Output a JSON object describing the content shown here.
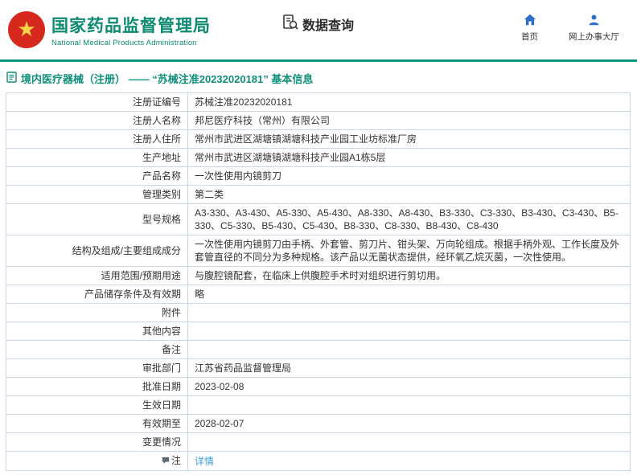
{
  "colors": {
    "accent_teal": "#0f9382",
    "title_teal": "#0d8a72",
    "nav_blue": "#2e6ec8",
    "emblem_red": "#d7281d",
    "emblem_gold": "#f8d549",
    "link_blue": "#3f9fd8",
    "table_border": "#c9d7e4"
  },
  "header": {
    "org_name_cn": "国家药品监督管理局",
    "org_name_en": "National Medical Products Administration",
    "section_title": "数据查询",
    "nav": [
      {
        "label": "首页",
        "icon": "home-icon"
      },
      {
        "label": "网上办事大厅",
        "icon": "person-icon"
      }
    ]
  },
  "breadcrumb": {
    "text": "境内医疗器械（注册） —— “苏械注准20232020181” 基本信息"
  },
  "table": {
    "rows": [
      {
        "label": "注册证编号",
        "value": "苏械注准20232020181"
      },
      {
        "label": "注册人名称",
        "value": "邦尼医疗科技（常州）有限公司"
      },
      {
        "label": "注册人住所",
        "value": "常州市武进区湖塘镇湖塘科技产业园工业坊标准厂房"
      },
      {
        "label": "生产地址",
        "value": "常州市武进区湖塘镇湖塘科技产业园A1栋5层"
      },
      {
        "label": "产品名称",
        "value": "一次性使用内镜剪刀"
      },
      {
        "label": "管理类别",
        "value": "第二类"
      },
      {
        "label": "型号规格",
        "value": "A3-330、A3-430、A5-330、A5-430、A8-330、A8-430、B3-330、C3-330、B3-430、C3-430、B5-330、C5-330、B5-430、C5-430、B8-330、C8-330、B8-430、C8-430"
      },
      {
        "label": "结构及组成/主要组成成分",
        "value": "一次性使用内镜剪刀由手柄、外套管、剪刀片、钳头架、万向轮组成。根据手柄外观、工作长度及外套管直径的不同分为多种规格。该产品以无菌状态提供，经环氧乙烷灭菌，一次性使用。"
      },
      {
        "label": "适用范围/预期用途",
        "value": "与腹腔镜配套，在临床上供腹腔手术时对组织进行剪切用。"
      },
      {
        "label": "产品储存条件及有效期",
        "value": "略"
      },
      {
        "label": "附件",
        "value": ""
      },
      {
        "label": "其他内容",
        "value": ""
      },
      {
        "label": "备注",
        "value": ""
      },
      {
        "label": "审批部门",
        "value": "江苏省药品监督管理局"
      },
      {
        "label": "批准日期",
        "value": "2023-02-08"
      },
      {
        "label": "生效日期",
        "value": ""
      },
      {
        "label": "有效期至",
        "value": "2028-02-07"
      },
      {
        "label": "变更情况",
        "value": ""
      },
      {
        "label": "注",
        "value": "详情"
      }
    ]
  }
}
